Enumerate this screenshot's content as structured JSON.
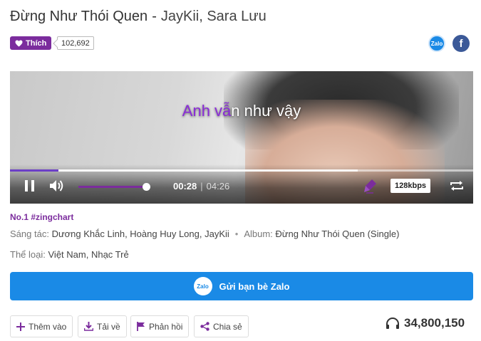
{
  "song": {
    "title": "Đừng Như Thói Quen",
    "separator": "-",
    "artists": "JayKii, Sara Lưu"
  },
  "like": {
    "label": "Thích",
    "count": "102,692"
  },
  "share_icons": {
    "zalo_label": "Zalo",
    "facebook_label": "f"
  },
  "player": {
    "lyric_sung": "Anh vẫ",
    "lyric_rest": "n như vậy",
    "current_time": "00:28",
    "divider": "|",
    "duration": "04:26",
    "progress_fraction": 0.105,
    "buffered_fraction": 0.75,
    "volume_fraction": 0.95,
    "quality": "128kbps"
  },
  "info": {
    "rank": "No.1 #zingchart",
    "composer_label": "Sáng tác:",
    "composers": "Dương Khắc Linh, Hoàng Huy Long, JayKii",
    "album_label": "Album:",
    "album": "Đừng Như Thói Quen (Single)",
    "genre_label": "Thể loại:",
    "genres": "Việt Nam, Nhạc Trẻ"
  },
  "zalo_share": {
    "logo": "Zalo",
    "label": "Gửi bạn bè Zalo"
  },
  "actions": {
    "add": "Thêm vào",
    "download": "Tải về",
    "report": "Phản hồi",
    "share": "Chia sẻ"
  },
  "listen_count": "34,800,150",
  "colors": {
    "accent": "#7b2c9d",
    "zalo": "#1a8ae6",
    "facebook": "#3b5998"
  }
}
